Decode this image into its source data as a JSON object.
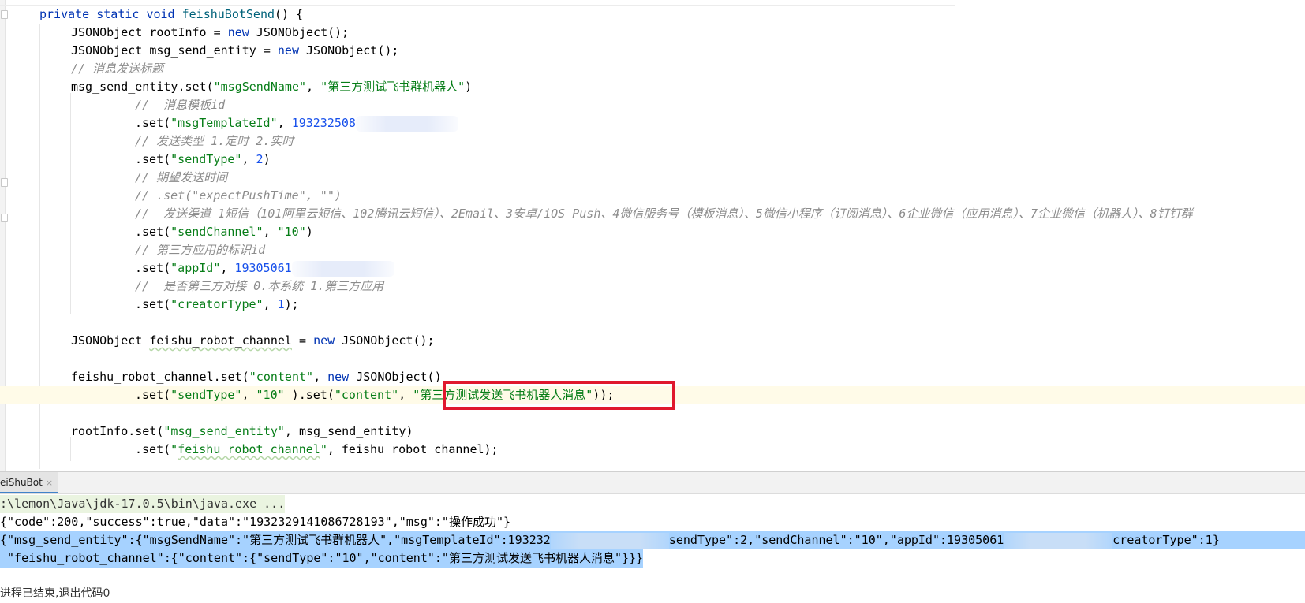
{
  "editor": {
    "lines": {
      "l1_kw": "private static void ",
      "l1_fn": "feishuBotSend",
      "l1_rest": "() {",
      "l2_a": "JSONObject rootInfo = ",
      "l2_kw": "new",
      "l2_b": " JSONObject();",
      "l3_a": "JSONObject msg_send_entity = ",
      "l3_kw": "new",
      "l3_b": " JSONObject();",
      "l4_cm": "// 消息发送标题",
      "l5_a": "msg_send_entity.set(",
      "l5_s1": "\"msgSendName\"",
      "l5_b": ", ",
      "l5_s2": "\"第三方测试飞书群机器人\"",
      "l5_c": ")",
      "l6_cm": "//  消息模板id",
      "l7_a": ".set(",
      "l7_s": "\"msgTemplateId\"",
      "l7_b": ", ",
      "l7_n": "193232508",
      "l8_cm": "// 发送类型 1.定时 2.实时",
      "l9_a": ".set(",
      "l9_s": "\"sendType\"",
      "l9_b": ", ",
      "l9_n": "2",
      "l9_c": ")",
      "l10_cm": "// 期望发送时间",
      "l11_cm": "// .set(\"expectPushTime\", \"\")",
      "l12_cm": "//  发送渠道 1短信（101阿里云短信、102腾讯云短信）、2Email、3安卓/iOS Push、4微信服务号（模板消息）、5微信小程序（订阅消息）、6企业微信（应用消息）、7企业微信（机器人）、8钉钉群",
      "l13_a": ".set(",
      "l13_s1": "\"sendChannel\"",
      "l13_b": ", ",
      "l13_s2": "\"10\"",
      "l13_c": ")",
      "l14_cm": "// 第三方应用的标识id",
      "l15_a": ".set(",
      "l15_s": "\"appId\"",
      "l15_b": ", ",
      "l15_n": "19305061",
      "l16_cm": "//  是否第三方对接 0.本系统 1.第三方应用",
      "l17_a": ".set(",
      "l17_s": "\"creatorType\"",
      "l17_b": ", ",
      "l17_n": "1",
      "l17_c": ");",
      "l19_a": "JSONObject ",
      "l19_v": "feishu_robot_channel",
      "l19_b": " = ",
      "l19_kw": "new",
      "l19_c": " JSONObject();",
      "l21_a": "feishu_robot_channel.set(",
      "l21_s": "\"content\"",
      "l21_b": ", ",
      "l21_kw": "new",
      "l21_c": " JSONObject()",
      "l22_a": ".set(",
      "l22_s1": "\"sendType\"",
      "l22_b": ", ",
      "l22_s2": "\"10\"",
      "l22_c": " ).set(",
      "l22_s3": "\"content\"",
      "l22_d": ", ",
      "l22_s4": "\"第三方测试发送飞书机器人消息\"",
      "l22_e": "));",
      "l24_a": "rootInfo.set(",
      "l24_s": "\"msg_send_entity\"",
      "l24_b": ", msg_send_entity)",
      "l25_a": ".set(",
      "l25_s1": "\"",
      "l25_s2": "feishu_robot_channel",
      "l25_s3": "\"",
      "l25_b": ", feishu_robot_channel);"
    }
  },
  "run_panel": {
    "tab_label": "eiShuBot",
    "tab_close": "×",
    "console": {
      "cmd": ":\\lemon\\Java\\jdk-17.0.5\\bin\\java.exe ...",
      "resp": "{\"code\":200,\"success\":true,\"data\":\"1932329141086728193\",\"msg\":\"操作成功\"}",
      "sel1_a": "{\"msg_send_entity\":{\"msgSendName\":\"第三方测试飞书群机器人\",\"msgTemplateId\":193232",
      "sel1_b": "sendType\":2,\"sendChannel\":\"10\",\"appId\":19305061",
      "sel1_c": "creatorType\":1}",
      "sel2": " \"feishu_robot_channel\":{\"content\":{\"sendType\":\"10\",\"content\":\"第三方测试发送飞书机器人消息\"}}}",
      "exit": "进程已结束,退出代码0"
    }
  },
  "colors": {
    "keyword": "#0033b3",
    "string": "#067d17",
    "number": "#1750eb",
    "comment": "#8c8c8c",
    "highlight_border": "#e0182d",
    "selection": "#a6d2ff"
  }
}
